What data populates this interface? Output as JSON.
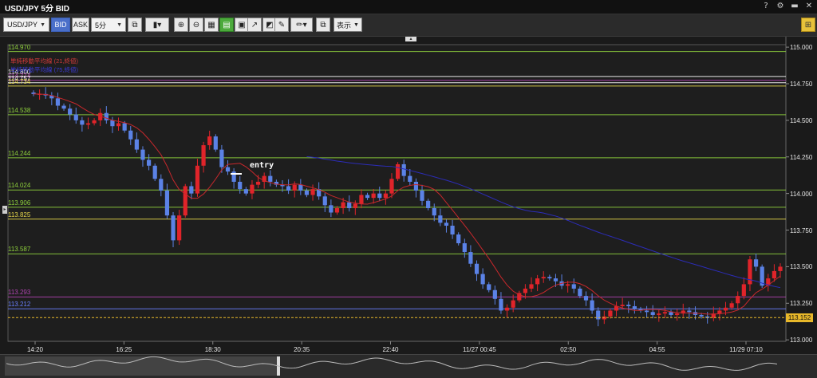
{
  "window": {
    "title": "USD/JPY 5分 BID",
    "controls": [
      {
        "name": "help-icon",
        "glyph": "?"
      },
      {
        "name": "gear-icon",
        "glyph": "⚙"
      },
      {
        "name": "minimize-icon",
        "glyph": "▬"
      },
      {
        "name": "close-icon",
        "glyph": "✕"
      }
    ]
  },
  "toolbar": {
    "symbol": "USD/JPY",
    "bid_label": "BID",
    "ask_label": "ASK",
    "timeframe": "5分",
    "display_label": "表示"
  },
  "chart_data": {
    "type": "candlestick",
    "ylim": [
      113.0,
      115.0
    ],
    "y_ticks": [
      "115.000",
      "114.750",
      "114.500",
      "114.250",
      "114.000",
      "113.750",
      "113.500",
      "113.250",
      "113.000"
    ],
    "x_ticks": [
      "14:20",
      "16:25",
      "18:30",
      "20:35",
      "22:40",
      "11/27 00:45",
      "02:50",
      "04:55",
      "11/29 07:10"
    ],
    "current_price": "113.152",
    "levels": [
      {
        "label": "114.970",
        "value": 114.97,
        "color": "#8fd13c"
      },
      {
        "label": "114.800",
        "value": 114.8,
        "color": "#ffffff"
      },
      {
        "label": "114.774",
        "value": 114.774,
        "color": "#b043b0"
      },
      {
        "label": "114.757",
        "value": 114.757,
        "color": "#ffffff"
      },
      {
        "label": "114.734",
        "value": 114.734,
        "color": "#e6d64a"
      },
      {
        "label": "114.538",
        "value": 114.538,
        "color": "#8fd13c"
      },
      {
        "label": "114.244",
        "value": 114.244,
        "color": "#8fd13c"
      },
      {
        "label": "114.024",
        "value": 114.024,
        "color": "#8fd13c"
      },
      {
        "label": "113.906",
        "value": 113.906,
        "color": "#8fd13c"
      },
      {
        "label": "113.825",
        "value": 113.825,
        "color": "#e6d64a"
      },
      {
        "label": "113.587",
        "value": 113.587,
        "color": "#8fd13c"
      },
      {
        "label": "113.293",
        "value": 113.293,
        "color": "#b043b0"
      },
      {
        "label": "113.212",
        "value": 113.212,
        "color": "#6a7fff"
      }
    ],
    "legend": [
      {
        "text": "単純移動平均線 (21,終値)",
        "color": "#d13a3a"
      },
      {
        "text": "単純移動平均線 (75,終値)",
        "color": "#3a3ad1"
      }
    ],
    "annotation": "entry",
    "candles_close": [
      114.68,
      114.68,
      114.67,
      114.65,
      114.6,
      114.58,
      114.54,
      114.5,
      114.47,
      114.48,
      114.5,
      114.55,
      114.5,
      114.46,
      114.48,
      114.43,
      114.37,
      114.3,
      114.23,
      114.19,
      114.1,
      114.02,
      113.85,
      113.68,
      113.85,
      114.05,
      114.0,
      114.19,
      114.33,
      114.39,
      114.3,
      114.18,
      114.15,
      114.08,
      114.03,
      114.0,
      114.06,
      114.08,
      114.12,
      114.08,
      114.06,
      114.05,
      114.02,
      114.06,
      114.02,
      113.99,
      114.03,
      113.98,
      113.92,
      113.87,
      113.9,
      113.94,
      113.9,
      113.93,
      113.99,
      113.97,
      114.0,
      113.97,
      114.0,
      114.1,
      114.2,
      114.12,
      114.08,
      114.02,
      113.95,
      113.9,
      113.85,
      113.8,
      113.78,
      113.72,
      113.66,
      113.6,
      113.52,
      113.45,
      113.38,
      113.34,
      113.28,
      113.2,
      113.22,
      113.27,
      113.32,
      113.35,
      113.38,
      113.42,
      113.43,
      113.42,
      113.4,
      113.37,
      113.38,
      113.35,
      113.3,
      113.27,
      113.2,
      113.14,
      113.16,
      113.2,
      113.23,
      113.24,
      113.23,
      113.21,
      113.2,
      113.19,
      113.17,
      113.18,
      113.19,
      113.17,
      113.18,
      113.2,
      113.19,
      113.17,
      113.16,
      113.15,
      113.18,
      113.2,
      113.22,
      113.25,
      113.3,
      113.38,
      113.55,
      113.5,
      113.37,
      113.42,
      113.47,
      113.5
    ]
  }
}
